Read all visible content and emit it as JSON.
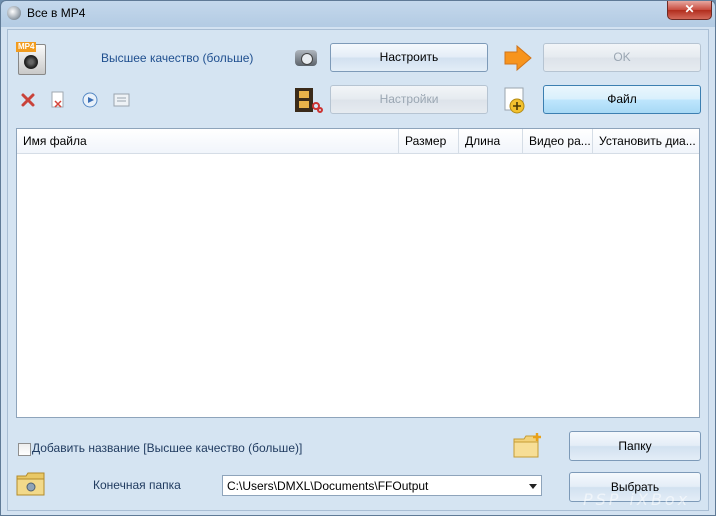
{
  "window": {
    "title": "Все в MP4",
    "close_glyph": "✕"
  },
  "profile": {
    "quality_label": "Высшее качество (больше)",
    "format_badge": "MP4"
  },
  "buttons": {
    "configure": "Настроить",
    "ok": "OK",
    "settings": "Настройки",
    "file": "Файл",
    "folder": "Папку",
    "choose": "Выбрать"
  },
  "table": {
    "columns": [
      "Имя файла",
      "Размер",
      "Длина",
      "Видео ра...",
      "Установить диа..."
    ],
    "rows": []
  },
  "options": {
    "add_name_label": "Добавить название [Высшее качество (больше)]",
    "add_name_checked": false
  },
  "output": {
    "label": "Конечная папка",
    "path": "C:\\Users\\DMXL\\Documents\\FFOutput"
  },
  "watermark": "PSP iXBox",
  "colors": {
    "accent_blue": "#1f4f8f",
    "arrow_orange": "#f7941d",
    "window_bg": "#d5e4f2"
  }
}
